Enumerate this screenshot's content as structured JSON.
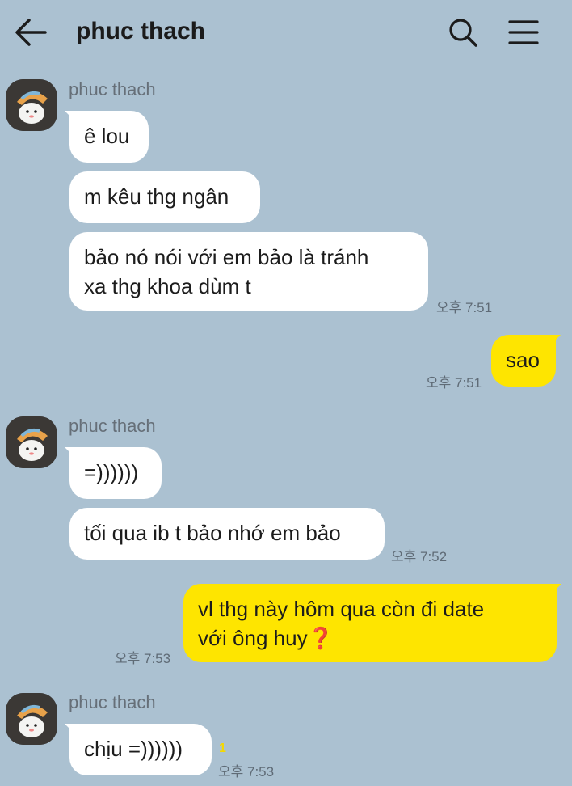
{
  "header": {
    "title": "phuc thach",
    "back_icon": "arrow-left-icon",
    "search_icon": "search-icon",
    "menu_icon": "menu-icon"
  },
  "colors": {
    "background": "#abc1d1",
    "incoming_bubble": "#ffffff",
    "outgoing_bubble": "#fee500"
  },
  "messages": [
    {
      "sender": "phuc thach",
      "bubbles": [
        "ê lou",
        "m kêu thg ngân",
        "bảo nó nói với em bảo là tránh",
        "xa thg khoa dùm t"
      ],
      "time": "오후 7:51"
    },
    {
      "mine": true,
      "text": "sao",
      "time": "오후 7:51"
    },
    {
      "sender": "phuc thach",
      "bubbles": [
        "=))))))",
        "tối qua ib t bảo nhớ em bảo"
      ],
      "time": "오후 7:52"
    },
    {
      "mine": true,
      "line1": "vl thg này hôm qua còn đi date",
      "line2": "với ông huy",
      "emoji": "❓",
      "time": "오후 7:53"
    },
    {
      "sender": "phuc thach",
      "bubbles": [
        "chịu =))))))"
      ],
      "unread": "1",
      "time": "오후 7:53"
    }
  ]
}
